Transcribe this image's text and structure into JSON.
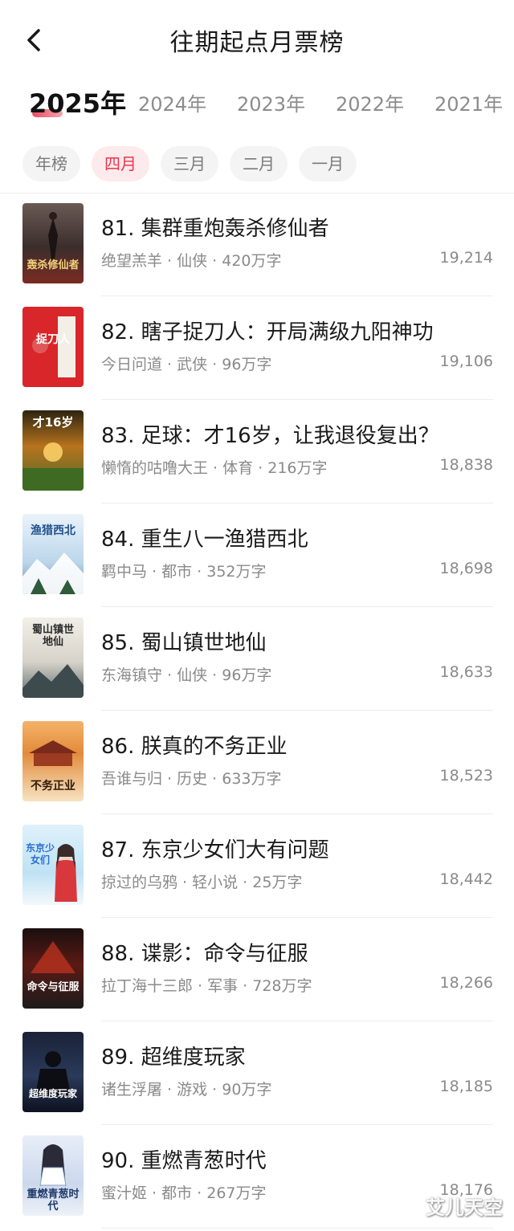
{
  "header": {
    "title": "往期起点月票榜"
  },
  "year_tabs": [
    {
      "label": "2025年",
      "active": true
    },
    {
      "label": "2024年",
      "active": false
    },
    {
      "label": "2023年",
      "active": false
    },
    {
      "label": "2022年",
      "active": false
    },
    {
      "label": "2021年",
      "active": false
    }
  ],
  "month_chips": [
    {
      "label": "年榜",
      "active": false
    },
    {
      "label": "四月",
      "active": true
    },
    {
      "label": "三月",
      "active": false
    },
    {
      "label": "二月",
      "active": false
    },
    {
      "label": "一月",
      "active": false
    }
  ],
  "books": [
    {
      "title": "81. 集群重炮轰杀修仙者",
      "meta": "绝望羔羊 · 仙侠 · 420万字",
      "votes": "19,214",
      "cover_text": "轰杀修仙者"
    },
    {
      "title": "82. 瞎子捉刀人：开局满级九阳神功",
      "meta": "今日问道 · 武侠 · 96万字",
      "votes": "19,106",
      "cover_text": "捉刀人"
    },
    {
      "title": "83. 足球：才16岁，让我退役复出？",
      "meta": "懒惰的咕噜大王 · 体育 · 216万字",
      "votes": "18,838",
      "cover_text": "才16岁"
    },
    {
      "title": "84. 重生八一渔猎西北",
      "meta": "羁中马 · 都市 · 352万字",
      "votes": "18,698",
      "cover_text": "渔猎西北"
    },
    {
      "title": "85. 蜀山镇世地仙",
      "meta": "东海镇守 · 仙侠 · 96万字",
      "votes": "18,633",
      "cover_text": "蜀山镇世地仙"
    },
    {
      "title": "86. 朕真的不务正业",
      "meta": "吾谁与归 · 历史 · 633万字",
      "votes": "18,523",
      "cover_text": "不务正业"
    },
    {
      "title": "87. 东京少女们大有问题",
      "meta": "掠过的乌鸦 · 轻小说 · 25万字",
      "votes": "18,442",
      "cover_text": "东京少女们"
    },
    {
      "title": "88. 谍影：命令与征服",
      "meta": "拉丁海十三郎 · 军事 · 728万字",
      "votes": "18,266",
      "cover_text": "命令与征服"
    },
    {
      "title": "89. 超维度玩家",
      "meta": "诸生浮屠 · 游戏 · 90万字",
      "votes": "18,185",
      "cover_text": "超维度玩家"
    },
    {
      "title": "90. 重燃青葱时代",
      "meta": "蜜汁姬 · 都市 · 267万字",
      "votes": "18,176",
      "cover_text": "重燃青葱时代"
    }
  ],
  "watermark": "艾儿天空"
}
